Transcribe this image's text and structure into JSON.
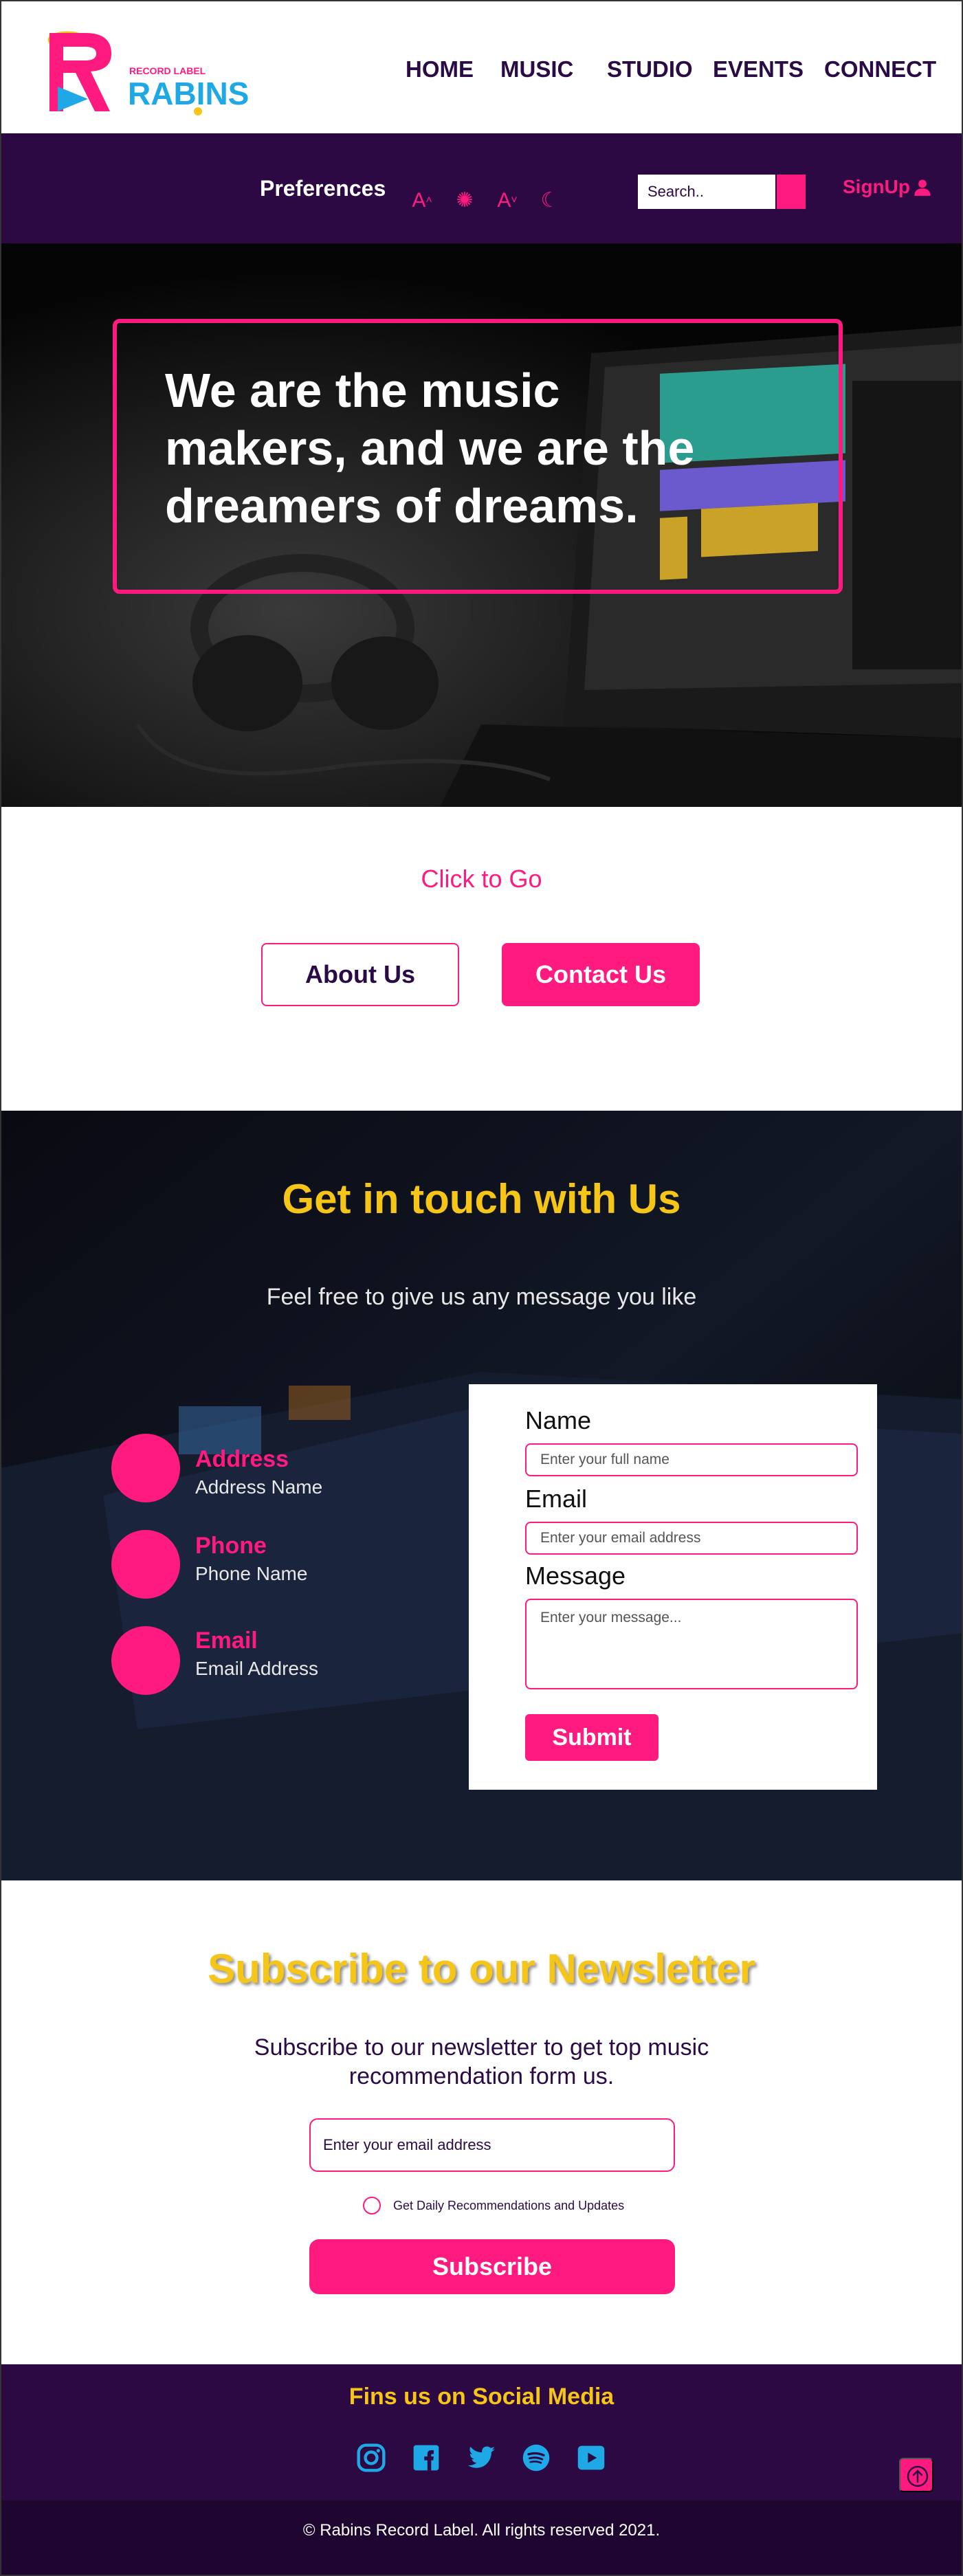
{
  "header": {
    "logo_subtitle": "RECORD LABEL",
    "logo_name": "RABINS",
    "nav": [
      "HOME",
      "MUSIC",
      "STUDIO",
      "EVENTS",
      "CONNECT"
    ]
  },
  "preferences": {
    "label": "Preferences",
    "icons": [
      "font-increase-icon",
      "brightness-icon",
      "font-decrease-icon",
      "dark-mode-icon"
    ],
    "search_placeholder": "Search..",
    "signup_label": "SignUp"
  },
  "hero": {
    "text": "We are the music makers, and we are the dreamers of dreams."
  },
  "click_to_go": {
    "label": "Click to Go",
    "about_label": "About Us",
    "contact_label": "Contact Us"
  },
  "contact": {
    "title": "Get in touch with Us",
    "subtitle": "Feel free to give us any message you like",
    "info": [
      {
        "title": "Address",
        "value": "Address Name"
      },
      {
        "title": "Phone",
        "value": "Phone Name"
      },
      {
        "title": "Email",
        "value": "Email Address"
      }
    ],
    "form": {
      "name_label": "Name",
      "name_placeholder": "Enter your full name",
      "email_label": "Email",
      "email_placeholder": "Enter your email address",
      "message_label": "Message",
      "message_placeholder": "Enter your message...",
      "submit_label": "Submit"
    }
  },
  "newsletter": {
    "title": "Subscribe to our Newsletter",
    "subtitle": "Subscribe to our newsletter to get top music recommendation form us.",
    "email_placeholder": "Enter your email address",
    "checkbox_label": "Get Daily Recommendations and Updates",
    "button_label": "Subscribe"
  },
  "social": {
    "title": "Fins us on Social Media",
    "icons": [
      "instagram-icon",
      "facebook-icon",
      "twitter-icon",
      "spotify-icon",
      "youtube-icon"
    ]
  },
  "footer": {
    "copyright": "© Rabins Record Label. All rights reserved 2021."
  },
  "colors": {
    "accent_pink": "#ff1a7f",
    "dark_purple": "#2d0944",
    "heading_yellow": "#f5c518",
    "logo_blue": "#1ea8e6"
  }
}
